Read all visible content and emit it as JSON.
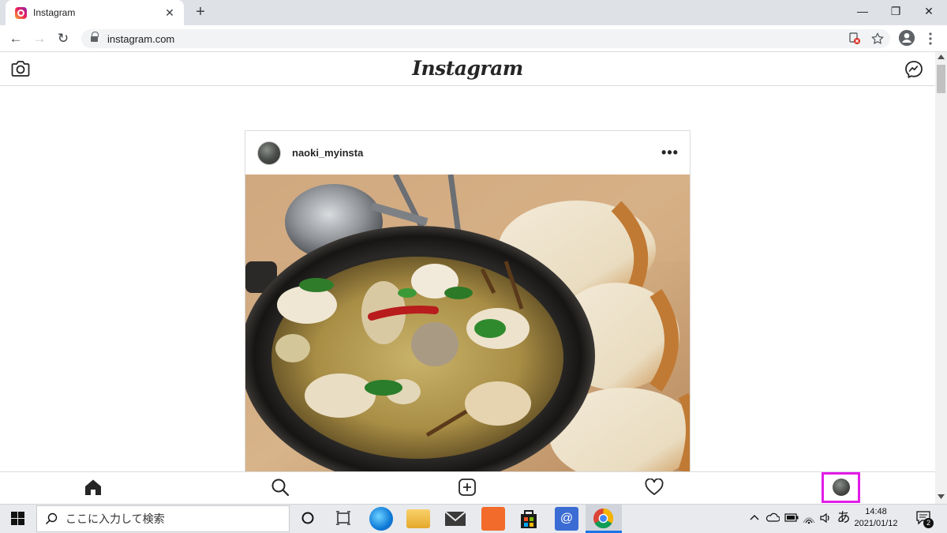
{
  "browser": {
    "tab_title": "Instagram",
    "tab_close": "✕",
    "new_tab": "+",
    "url": "instagram.com",
    "window_controls": {
      "minimize": "—",
      "restore": "❐",
      "close": "✕"
    },
    "nav": {
      "back": "←",
      "forward": "→",
      "reload": "↻"
    },
    "icons": [
      "lock-icon",
      "blocked-content-icon",
      "bookmark-star-icon",
      "account-icon",
      "menu-icon"
    ]
  },
  "instagram": {
    "logo": "Instagram",
    "header_icons": [
      "camera-icon",
      "messenger-icon"
    ],
    "post": {
      "username": "naoki_myinsta",
      "more": "•••"
    },
    "bottom_nav": [
      "home-icon",
      "search-icon",
      "new-post-icon",
      "activity-heart-icon",
      "profile-avatar"
    ]
  },
  "taskbar": {
    "search_placeholder": "ここに入力して検索",
    "time": "14:48",
    "date": "2021/01/12",
    "ime": "あ",
    "notification_count": "2"
  },
  "colors": {
    "highlight": "#e21ce8",
    "chrome_frame": "#dee1e6",
    "ig_border": "#dbdbdb",
    "text": "#262626"
  }
}
